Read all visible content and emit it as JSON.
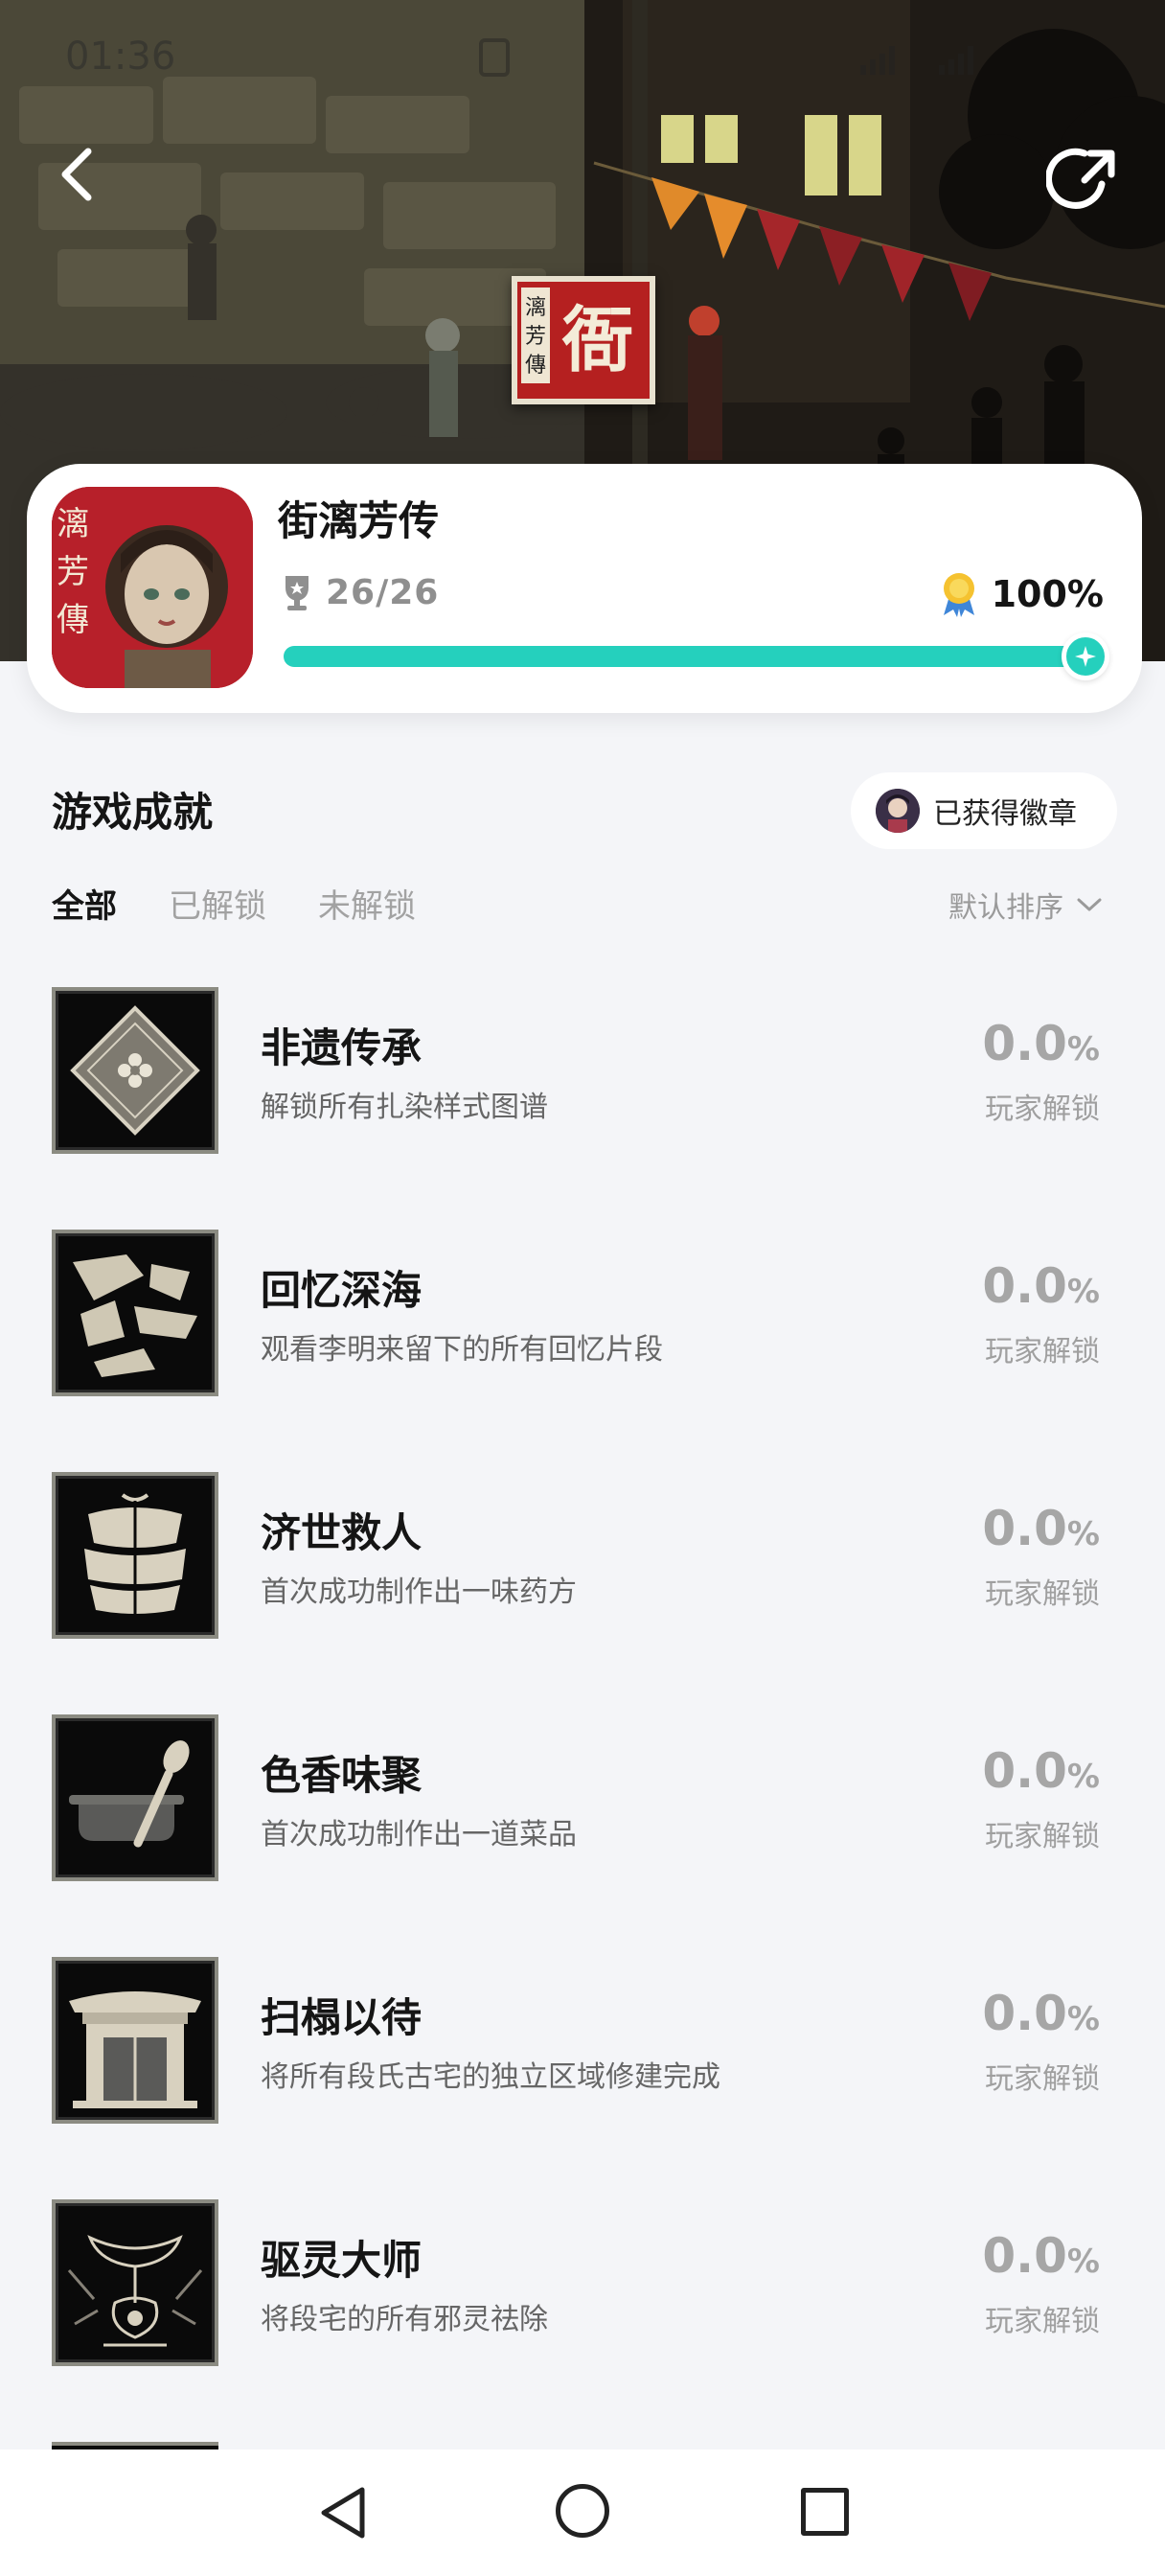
{
  "status_bar": {
    "time": "01:36"
  },
  "banner": {
    "logo_text": "衙"
  },
  "game": {
    "title": "街漓芳传",
    "trophy_count": "26/26",
    "completion": "100%",
    "progress": 1.0
  },
  "section": {
    "title": "游戏成就",
    "badge_button": "已获得徽章"
  },
  "tabs": [
    {
      "label": "全部",
      "active": true
    },
    {
      "label": "已解锁",
      "active": false
    },
    {
      "label": "未解锁",
      "active": false
    }
  ],
  "sort": {
    "label": "默认排序"
  },
  "achievements": [
    {
      "name": "非遗传承",
      "desc": "解锁所有扎染样式图谱",
      "pct": "0.0",
      "unit": "%",
      "sub": "玩家解锁",
      "icon": "diamond-flower-icon"
    },
    {
      "name": "回忆深海",
      "desc": "观看李明来留下的所有回忆片段",
      "pct": "0.0",
      "unit": "%",
      "sub": "玩家解锁",
      "icon": "fragments-icon"
    },
    {
      "name": "济世救人",
      "desc": "首次成功制作出一味药方",
      "pct": "0.0",
      "unit": "%",
      "sub": "玩家解锁",
      "icon": "medicine-pack-icon"
    },
    {
      "name": "色香味聚",
      "desc": "首次成功制作出一道菜品",
      "pct": "0.0",
      "unit": "%",
      "sub": "玩家解锁",
      "icon": "cooking-pot-icon"
    },
    {
      "name": "扫榻以待",
      "desc": "将所有段氏古宅的独立区域修建完成",
      "pct": "0.0",
      "unit": "%",
      "sub": "玩家解锁",
      "icon": "gate-house-icon"
    },
    {
      "name": "驱灵大师",
      "desc": "将段宅的所有邪灵祛除",
      "pct": "0.0",
      "unit": "%",
      "sub": "玩家解锁",
      "icon": "incense-burner-icon"
    }
  ],
  "colors": {
    "accent": "#25d0bd",
    "background": "#f4f5f8"
  }
}
